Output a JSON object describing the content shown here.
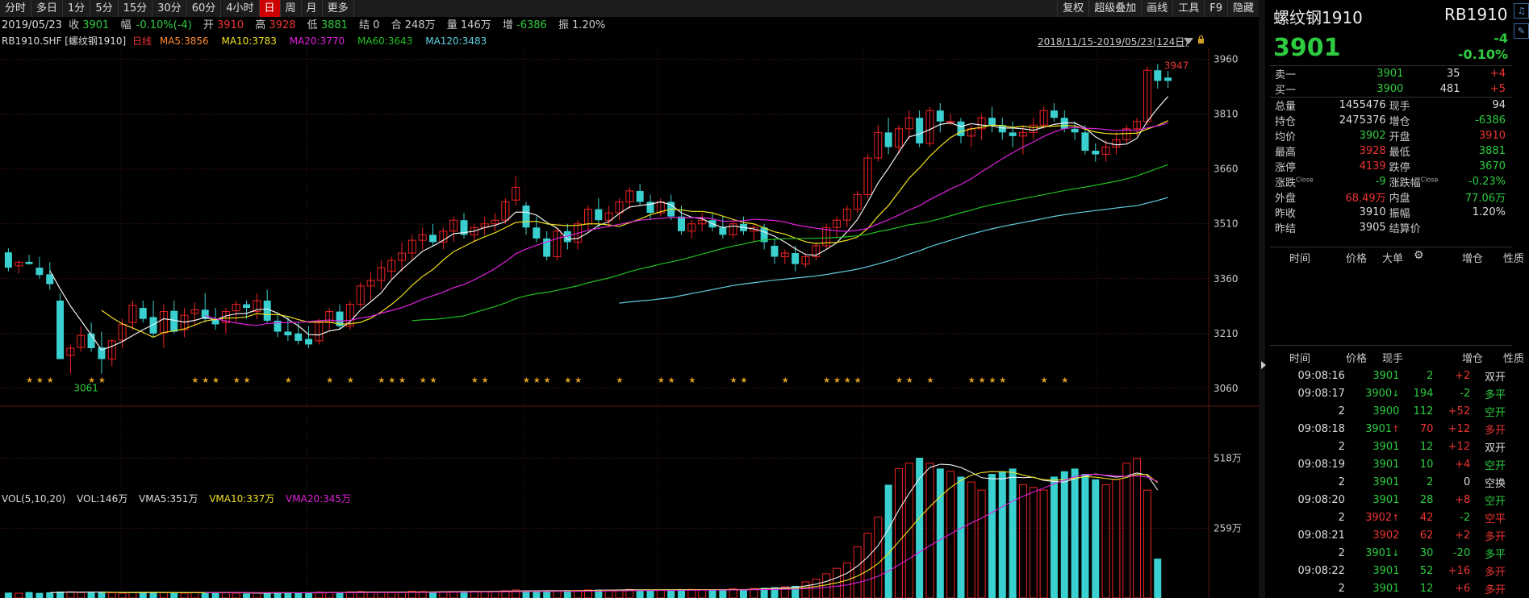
{
  "toolbar": {
    "left": [
      "分时",
      "多日",
      "1分",
      "5分",
      "15分",
      "30分",
      "60分",
      "4小时",
      "日",
      "周",
      "月",
      "更多"
    ],
    "active": "日",
    "right": [
      "复权",
      "超级叠加",
      "画线",
      "工具",
      "F9",
      "隐藏"
    ]
  },
  "quote_bar": {
    "date": "2019/05/23",
    "close_label": "收",
    "close": "3901",
    "amp_label": "幅",
    "amp": "-0.10%(-4)",
    "open_label": "开",
    "open": "3910",
    "high_label": "高",
    "high": "3928",
    "low_label": "低",
    "low": "3881",
    "settle_label": "结",
    "settle": "0",
    "oi_label": "合",
    "oi": "248万",
    "vol_label": "量",
    "vol": "146万",
    "inc_label": "增",
    "inc": "-6386",
    "swing_label": "振",
    "swing": "1.20%"
  },
  "ma_bar": {
    "symbol": "RB1910.SHF [螺纹钢1910]",
    "period": "日线",
    "ma5": "MA5:3856",
    "ma10": "MA10:3783",
    "ma20": "MA20:3770",
    "ma60": "MA60:3643",
    "ma120": "MA120:3483"
  },
  "range_label": "2018/11/15-2019/05/23(124日)",
  "axis": {
    "price_ticks": [
      "3960",
      "3810",
      "3660",
      "3510",
      "3360",
      "3210",
      "3060"
    ],
    "vol_ticks": [
      "518万",
      "259万"
    ],
    "max_label": "3947",
    "min_label": "3061"
  },
  "vol_bar": {
    "title": "VOL(5,10,20)",
    "vol": "VOL:146万",
    "vma5": "VMA5:351万",
    "vma10": "VMA10:337万",
    "vma20": "VMA20:345万"
  },
  "colors": {
    "up": "#ee2222",
    "down": "#3ad0d0",
    "ma5": "#ffffff",
    "ma10": "#f0e020",
    "ma20": "#e020e0",
    "ma60": "#20c020",
    "ma120": "#60d0e0",
    "grid": "#3a1010"
  },
  "chart_data": {
    "type": "candlestick",
    "ylim": [
      3020,
      3990
    ],
    "candles": [
      [
        3432,
        3443,
        3380,
        3390
      ],
      [
        3395,
        3410,
        3375,
        3405
      ],
      [
        3406,
        3425,
        3398,
        3400
      ],
      [
        3390,
        3420,
        3360,
        3370
      ],
      [
        3372,
        3405,
        3330,
        3345
      ],
      [
        3300,
        3320,
        3150,
        3140
      ],
      [
        3150,
        3180,
        3100,
        3170
      ],
      [
        3172,
        3230,
        3160,
        3205
      ],
      [
        3210,
        3240,
        3160,
        3170
      ],
      [
        3172,
        3215,
        3100,
        3140
      ],
      [
        3140,
        3195,
        3120,
        3190
      ],
      [
        3192,
        3250,
        3170,
        3235
      ],
      [
        3240,
        3300,
        3220,
        3287
      ],
      [
        3280,
        3300,
        3240,
        3250
      ],
      [
        3255,
        3300,
        3200,
        3210
      ],
      [
        3212,
        3290,
        3170,
        3270
      ],
      [
        3272,
        3300,
        3210,
        3215
      ],
      [
        3220,
        3280,
        3200,
        3260
      ],
      [
        3265,
        3295,
        3230,
        3275
      ],
      [
        3275,
        3320,
        3240,
        3250
      ],
      [
        3250,
        3280,
        3220,
        3235
      ],
      [
        3240,
        3280,
        3210,
        3270
      ],
      [
        3272,
        3300,
        3240,
        3290
      ],
      [
        3290,
        3300,
        3250,
        3280
      ],
      [
        3270,
        3320,
        3250,
        3300
      ],
      [
        3300,
        3330,
        3240,
        3245
      ],
      [
        3245,
        3260,
        3200,
        3215
      ],
      [
        3215,
        3255,
        3190,
        3205
      ],
      [
        3210,
        3240,
        3180,
        3190
      ],
      [
        3195,
        3230,
        3170,
        3180
      ],
      [
        3190,
        3250,
        3180,
        3240
      ],
      [
        3240,
        3280,
        3220,
        3270
      ],
      [
        3270,
        3290,
        3220,
        3230
      ],
      [
        3230,
        3300,
        3220,
        3290
      ],
      [
        3290,
        3350,
        3280,
        3340
      ],
      [
        3340,
        3380,
        3300,
        3355
      ],
      [
        3355,
        3410,
        3330,
        3390
      ],
      [
        3380,
        3420,
        3360,
        3410
      ],
      [
        3410,
        3460,
        3380,
        3430
      ],
      [
        3430,
        3480,
        3410,
        3465
      ],
      [
        3465,
        3500,
        3440,
        3480
      ],
      [
        3480,
        3510,
        3450,
        3460
      ],
      [
        3460,
        3500,
        3440,
        3490
      ],
      [
        3490,
        3530,
        3460,
        3520
      ],
      [
        3520,
        3540,
        3470,
        3480
      ],
      [
        3480,
        3510,
        3460,
        3500
      ],
      [
        3500,
        3530,
        3480,
        3510
      ],
      [
        3510,
        3540,
        3490,
        3520
      ],
      [
        3520,
        3580,
        3510,
        3570
      ],
      [
        3575,
        3640,
        3560,
        3610
      ],
      [
        3560,
        3570,
        3480,
        3500
      ],
      [
        3500,
        3530,
        3460,
        3470
      ],
      [
        3470,
        3490,
        3410,
        3420
      ],
      [
        3420,
        3500,
        3410,
        3490
      ],
      [
        3490,
        3510,
        3440,
        3460
      ],
      [
        3460,
        3520,
        3440,
        3510
      ],
      [
        3510,
        3560,
        3490,
        3550
      ],
      [
        3550,
        3580,
        3500,
        3520
      ],
      [
        3520,
        3560,
        3500,
        3540
      ],
      [
        3540,
        3580,
        3520,
        3570
      ],
      [
        3570,
        3610,
        3550,
        3600
      ],
      [
        3600,
        3620,
        3560,
        3570
      ],
      [
        3570,
        3590,
        3520,
        3540
      ],
      [
        3540,
        3580,
        3530,
        3570
      ],
      [
        3570,
        3590,
        3520,
        3530
      ],
      [
        3530,
        3560,
        3480,
        3490
      ],
      [
        3490,
        3520,
        3470,
        3510
      ],
      [
        3510,
        3540,
        3490,
        3520
      ],
      [
        3520,
        3540,
        3490,
        3500
      ],
      [
        3500,
        3530,
        3470,
        3480
      ],
      [
        3480,
        3520,
        3470,
        3510
      ],
      [
        3510,
        3530,
        3480,
        3490
      ],
      [
        3490,
        3510,
        3460,
        3500
      ],
      [
        3500,
        3510,
        3440,
        3460
      ],
      [
        3450,
        3470,
        3400,
        3420
      ],
      [
        3420,
        3440,
        3400,
        3430
      ],
      [
        3430,
        3450,
        3380,
        3400
      ],
      [
        3400,
        3430,
        3390,
        3420
      ],
      [
        3420,
        3460,
        3410,
        3450
      ],
      [
        3450,
        3510,
        3440,
        3500
      ],
      [
        3500,
        3530,
        3470,
        3520
      ],
      [
        3520,
        3560,
        3500,
        3550
      ],
      [
        3550,
        3600,
        3540,
        3590
      ],
      [
        3590,
        3700,
        3580,
        3690
      ],
      [
        3690,
        3780,
        3680,
        3760
      ],
      [
        3760,
        3800,
        3700,
        3720
      ],
      [
        3720,
        3780,
        3700,
        3770
      ],
      [
        3770,
        3820,
        3740,
        3800
      ],
      [
        3800,
        3820,
        3720,
        3730
      ],
      [
        3730,
        3830,
        3720,
        3820
      ],
      [
        3820,
        3840,
        3760,
        3790
      ],
      [
        3790,
        3810,
        3780,
        3790
      ],
      [
        3790,
        3800,
        3730,
        3750
      ],
      [
        3750,
        3780,
        3720,
        3770
      ],
      [
        3770,
        3810,
        3740,
        3800
      ],
      [
        3800,
        3830,
        3760,
        3780
      ],
      [
        3780,
        3800,
        3740,
        3760
      ],
      [
        3760,
        3790,
        3720,
        3750
      ],
      [
        3750,
        3780,
        3700,
        3760
      ],
      [
        3760,
        3800,
        3740,
        3780
      ],
      [
        3780,
        3830,
        3770,
        3820
      ],
      [
        3820,
        3840,
        3790,
        3800
      ],
      [
        3800,
        3820,
        3760,
        3770
      ],
      [
        3770,
        3790,
        3740,
        3760
      ],
      [
        3760,
        3780,
        3700,
        3710
      ],
      [
        3710,
        3730,
        3680,
        3700
      ],
      [
        3700,
        3740,
        3680,
        3720
      ],
      [
        3720,
        3760,
        3700,
        3740
      ],
      [
        3740,
        3780,
        3730,
        3770
      ],
      [
        3770,
        3800,
        3750,
        3790
      ],
      [
        3790,
        3940,
        3780,
        3930
      ],
      [
        3930,
        3947,
        3880,
        3901
      ],
      [
        3910,
        3928,
        3881,
        3901
      ]
    ],
    "volume_ticks": [
      0,
      259,
      518
    ],
    "volumes_wan": [
      20,
      18,
      22,
      19,
      21,
      24,
      23,
      20,
      22,
      21,
      19,
      18,
      20,
      22,
      21,
      20,
      19,
      18,
      21,
      22,
      20,
      19,
      18,
      17,
      19,
      20,
      21,
      19,
      18,
      20,
      22,
      21,
      20,
      23,
      24,
      22,
      21,
      20,
      22,
      25,
      24,
      23,
      22,
      24,
      26,
      25,
      24,
      23,
      27,
      30,
      28,
      26,
      25,
      27,
      29,
      28,
      30,
      31,
      29,
      30,
      32,
      31,
      30,
      29,
      31,
      33,
      32,
      30,
      29,
      31,
      34,
      33,
      35,
      38,
      40,
      42,
      45,
      60,
      70,
      90,
      110,
      130,
      190,
      240,
      300,
      420,
      480,
      500,
      520,
      500,
      480,
      470,
      450,
      430,
      400,
      460,
      470,
      480,
      420,
      410,
      400,
      450,
      470,
      480,
      460,
      440,
      420,
      440,
      500,
      518,
      400,
      146
    ]
  },
  "panel": {
    "name": "螺纹钢1910",
    "code": "RB1910",
    "price": "3901",
    "change": "-4",
    "change_pct": "-0.10%",
    "ask_label": "卖一",
    "ask": "3901",
    "ask_vol": "35",
    "ask_inc": "+4",
    "bid_label": "买一",
    "bid": "3900",
    "bid_vol": "481",
    "bid_inc": "+5",
    "stats": [
      [
        "总量",
        "1455476",
        "现手",
        "94"
      ],
      [
        "持仓",
        "2475376",
        "增仓",
        "-6386"
      ],
      [
        "均价",
        "3902",
        "开盘",
        "3910"
      ],
      [
        "最高",
        "3928",
        "最低",
        "3881"
      ],
      [
        "涨停",
        "4139",
        "跌停",
        "3670"
      ],
      [
        "涨跌",
        "-9",
        "涨跌幅",
        "-0.23%"
      ],
      [
        "外盘",
        "68.49万",
        "内盘",
        "77.06万"
      ],
      [
        "昨收",
        "3910",
        "振幅",
        "1.20%"
      ],
      [
        "昨结",
        "3905",
        "结算价",
        ""
      ]
    ],
    "close_sup": "Close",
    "big_header": [
      "时间",
      "价格",
      "大单",
      "增仓",
      "性质"
    ],
    "tick_header": [
      "时间",
      "价格",
      "现手",
      "增仓",
      "性质"
    ],
    "ticks": [
      [
        "09:08:16",
        "3901",
        "",
        "2",
        "+2",
        "双开"
      ],
      [
        "09:08:17",
        "3900",
        "down",
        "194",
        "-2",
        "多平"
      ],
      [
        "2",
        "3900",
        "",
        "112",
        "+52",
        "空开"
      ],
      [
        "09:08:18",
        "3901",
        "up",
        "70",
        "+12",
        "多开"
      ],
      [
        "2",
        "3901",
        "",
        "12",
        "+12",
        "双开"
      ],
      [
        "09:08:19",
        "3901",
        "",
        "10",
        "+4",
        "空开"
      ],
      [
        "2",
        "3901",
        "",
        "2",
        "0",
        "空换"
      ],
      [
        "09:08:20",
        "3901",
        "",
        "28",
        "+8",
        "空开"
      ],
      [
        "2",
        "3902",
        "up",
        "42",
        "-2",
        "空平"
      ],
      [
        "09:08:21",
        "3902",
        "",
        "62",
        "+2",
        "多开"
      ],
      [
        "2",
        "3901",
        "down",
        "30",
        "-20",
        "多平"
      ],
      [
        "09:08:22",
        "3901",
        "",
        "52",
        "+16",
        "多开"
      ],
      [
        "2",
        "3901",
        "",
        "12",
        "+6",
        "多开"
      ]
    ]
  }
}
